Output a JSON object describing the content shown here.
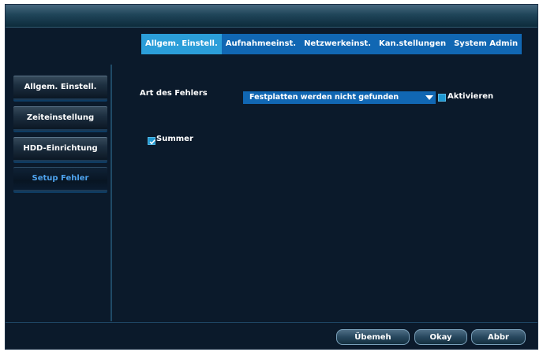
{
  "tabs": [
    {
      "label": "Allgem. Einstell.",
      "active": true
    },
    {
      "label": "Aufnahmeeinst.",
      "active": false
    },
    {
      "label": "Netzwerkeinst.",
      "active": false
    },
    {
      "label": "Kan.stellungen",
      "active": false
    },
    {
      "label": "System Admin",
      "active": false
    }
  ],
  "sidebar": {
    "items": [
      {
        "label": "Allgem. Einstell.",
        "active": false
      },
      {
        "label": "Zeiteinstellung",
        "active": false
      },
      {
        "label": "HDD-Einrichtung",
        "active": false
      },
      {
        "label": "Setup Fehler",
        "active": true
      }
    ]
  },
  "form": {
    "error_type_label": "Art des Fehlers",
    "error_type_value": "Festplatten werden nicht gefunden",
    "activate_label": "Aktivieren",
    "activate_checked": false,
    "buzzer_label": "Summer",
    "buzzer_checked": true
  },
  "buttons": {
    "apply": "Übemeh",
    "ok": "Okay",
    "cancel": "Abbr"
  },
  "colors": {
    "background": "#0b1a2b",
    "tab_bar": "#1167b3",
    "tab_active": "#2b9ed9",
    "sidebar_active_text": "#4ea3ee"
  }
}
